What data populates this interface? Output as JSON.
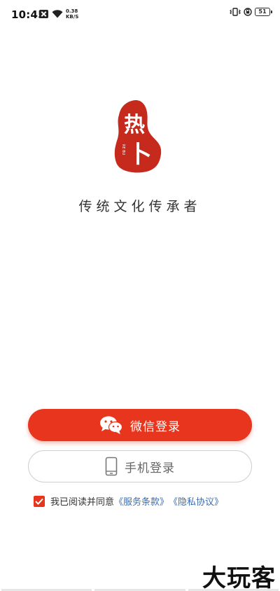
{
  "status_bar": {
    "time": "10:45",
    "net_speed_value": "0.38",
    "net_speed_unit": "KB/S",
    "battery_level": "51"
  },
  "app": {
    "logo_text": "热卜",
    "logo_pinyin": "RE BU",
    "tagline": "传统文化传承者"
  },
  "login": {
    "wechat_label": "微信登录",
    "phone_label": "手机登录"
  },
  "agreement": {
    "checked": true,
    "prefix": "我已阅读并同意",
    "terms_link": "《服务条款》",
    "privacy_link": "《隐私协议》"
  },
  "watermark": {
    "text": "大玩客"
  },
  "colors": {
    "accent": "#e8351e",
    "link": "#3a6db5"
  },
  "icons": {
    "wechat": "wechat-icon",
    "phone": "phone-icon",
    "check": "check-icon",
    "wifi": "wifi-icon",
    "battery": "battery-icon"
  }
}
